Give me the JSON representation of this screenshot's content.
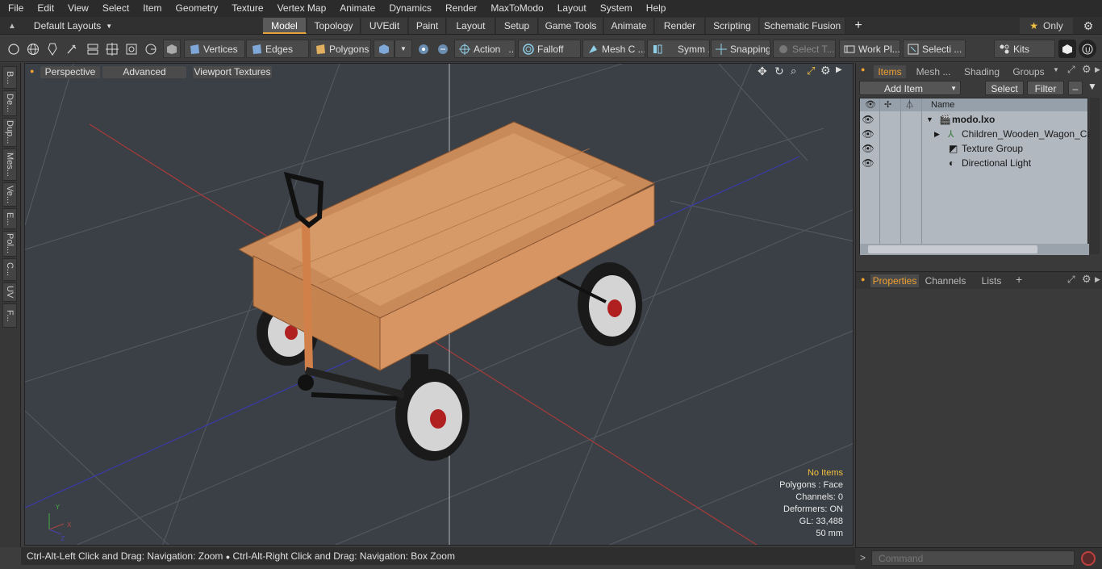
{
  "menu": [
    "File",
    "Edit",
    "View",
    "Select",
    "Item",
    "Geometry",
    "Texture",
    "Vertex Map",
    "Animate",
    "Dynamics",
    "Render",
    "MaxToModo",
    "Layout",
    "System",
    "Help"
  ],
  "layouts_label": "Default Layouts",
  "tabs": [
    "Model",
    "Topology",
    "UVEdit",
    "Paint",
    "Layout",
    "Setup",
    "Game Tools",
    "Animate",
    "Render",
    "Scripting",
    "Schematic Fusion"
  ],
  "only_label": "Only",
  "toolbar": {
    "vertices": "Vertices",
    "edges": "Edges",
    "polygons": "Polygons",
    "action": "Action",
    "falloff": "Falloff",
    "mesh": "Mesh C ...",
    "symm": "Symm ...",
    "snapping": "Snapping",
    "select_t": "Select T...",
    "work_pl": "Work Pl...",
    "selecti": "Selecti ...",
    "kits": "Kits"
  },
  "left_tabs": [
    "B...",
    "De...",
    "Dup...",
    "Mes...",
    "Ve...",
    "E...",
    "Pol...",
    "C...",
    "UV",
    "F..."
  ],
  "viewport": {
    "perspective": "Perspective",
    "advanced": "Advanced",
    "viewport_textures": "Viewport Textures",
    "stats": {
      "no_items": "No Items",
      "polygons": "Polygons : Face",
      "channels": "Channels: 0",
      "deformers": "Deformers: ON",
      "gl": "GL: 33,488",
      "mm": "50 mm"
    },
    "axis": {
      "y": "Y",
      "x": "X",
      "z": "Z"
    }
  },
  "status": {
    "part1": "Ctrl-Alt-Left Click and Drag: Navigation: Zoom",
    "part2": "Ctrl-Alt-Right Click and Drag: Navigation: Box Zoom"
  },
  "right": {
    "tabs": [
      "Items",
      "Mesh ...",
      "Shading",
      "Groups"
    ],
    "add_item": "Add Item",
    "select": "Select",
    "filter": "Filter",
    "name_header": "Name",
    "items": [
      {
        "name": "modo.lxo"
      },
      {
        "name": "Children_Wooden_Wagon_Cart"
      },
      {
        "name": "Texture Group"
      },
      {
        "name": "Directional Light"
      }
    ],
    "lower_tabs": [
      "Properties",
      "Channels",
      "Lists"
    ],
    "command_placeholder": "Command"
  },
  "colors": {
    "accent": "#f0a030",
    "stat_highlight": "#f0c040"
  }
}
